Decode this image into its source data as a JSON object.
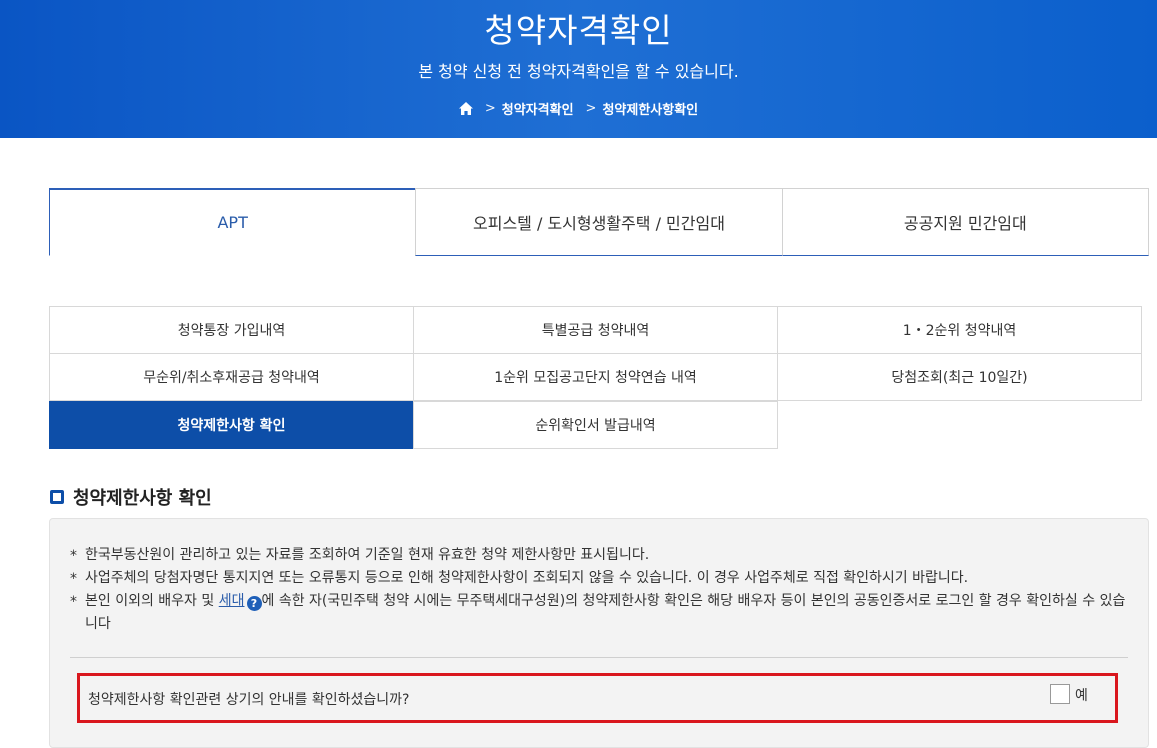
{
  "header": {
    "title": "청약자격확인",
    "subtitle": "본 청약 신청 전 청약자격확인을 할 수 있습니다.",
    "breadcrumb": [
      "청약자격확인",
      "청약제한사항확인"
    ]
  },
  "colors": {
    "brand_blue": "#0d4ea8",
    "alert_red": "#d9161d"
  },
  "tabs": [
    {
      "label": "APT",
      "active": true
    },
    {
      "label": "오피스텔 / 도시형생활주택 / 민간임대"
    },
    {
      "label": "공공지원 민간임대"
    }
  ],
  "subtabs": [
    "청약통장 가입내역",
    "특별공급 청약내역",
    "1・2순위 청약내역",
    "무순위/취소후재공급 청약내역",
    "1순위 모집공고단지 청약연습 내역",
    "당첨조회(최근 10일간)",
    "청약제한사항 확인",
    "순위확인서 발급내역"
  ],
  "section": {
    "title": "청약제한사항 확인",
    "notes": [
      "한국부동산원이 관리하고 있는 자료를 조회하여 기준일 현재 유효한 청약 제한사항만 표시됩니다.",
      "사업주체의 당첨자명단 통지지연 또는 오류통지 등으로 인해 청약제한사항이 조회되지 않을 수 있습니다. 이 경우 사업주체로 직접 확인하시기 바랍니다."
    ],
    "note3_prefix": "본인 이외의 배우자 및 ",
    "note3_link": "세대",
    "note3_suffix": "에 속한 자(국민주택 청약 시에는 무주택세대구성원)의 청약제한사항 확인은 해당 배우자 등이 본인의 공동인증서로 로그인 할 경우 확인하실 수 있습니다",
    "help_icon": "?",
    "confirm_question": "청약제한사항 확인관련 상기의 안내를 확인하셨습니까?",
    "confirm_option": "예"
  }
}
